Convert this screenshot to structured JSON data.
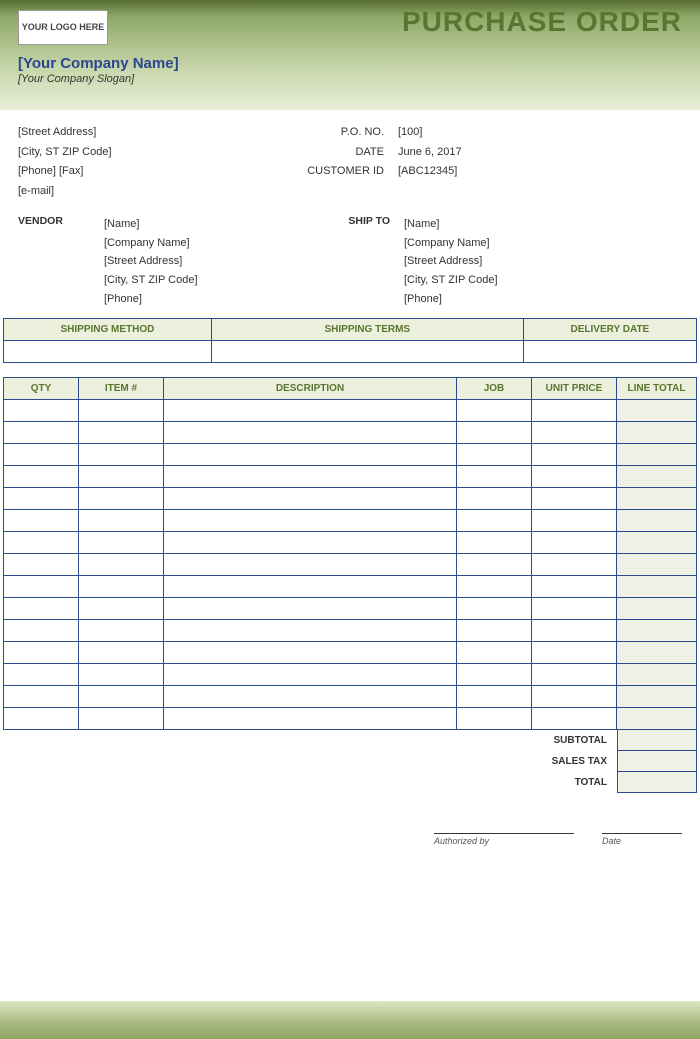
{
  "header": {
    "logo_text": "YOUR LOGO HERE",
    "title": "PURCHASE ORDER",
    "company_name": "[Your Company Name]",
    "company_slogan": "[Your Company Slogan]"
  },
  "sender": {
    "street": "[Street Address]",
    "city": "[City, ST  ZIP Code]",
    "phone_fax": "[Phone] [Fax]",
    "email": "[e-mail]"
  },
  "po_meta": {
    "po_no_label": "P.O. NO.",
    "po_no_value": "[100]",
    "date_label": "DATE",
    "date_value": "June 6, 2017",
    "customer_id_label": "CUSTOMER ID",
    "customer_id_value": "[ABC12345]"
  },
  "vendor": {
    "label": "VENDOR",
    "name": "[Name]",
    "company": "[Company Name]",
    "street": "[Street Address]",
    "city": "[City, ST  ZIP Code]",
    "phone": "[Phone]"
  },
  "shipto": {
    "label": "SHIP TO",
    "name": "[Name]",
    "company": "[Company Name]",
    "street": "[Street Address]",
    "city": "[City, ST  ZIP Code]",
    "phone": "[Phone]"
  },
  "shipping": {
    "headers": {
      "method": "SHIPPING METHOD",
      "terms": "SHIPPING TERMS",
      "delivery": "DELIVERY DATE"
    },
    "values": {
      "method": "",
      "terms": "",
      "delivery": ""
    }
  },
  "items_headers": {
    "qty": "QTY",
    "item": "ITEM #",
    "desc": "DESCRIPTION",
    "job": "JOB",
    "price": "UNIT PRICE",
    "total": "LINE TOTAL"
  },
  "line_items": [
    {
      "qty": "",
      "item": "",
      "desc": "",
      "job": "",
      "price": "",
      "total": ""
    },
    {
      "qty": "",
      "item": "",
      "desc": "",
      "job": "",
      "price": "",
      "total": ""
    },
    {
      "qty": "",
      "item": "",
      "desc": "",
      "job": "",
      "price": "",
      "total": ""
    },
    {
      "qty": "",
      "item": "",
      "desc": "",
      "job": "",
      "price": "",
      "total": ""
    },
    {
      "qty": "",
      "item": "",
      "desc": "",
      "job": "",
      "price": "",
      "total": ""
    },
    {
      "qty": "",
      "item": "",
      "desc": "",
      "job": "",
      "price": "",
      "total": ""
    },
    {
      "qty": "",
      "item": "",
      "desc": "",
      "job": "",
      "price": "",
      "total": ""
    },
    {
      "qty": "",
      "item": "",
      "desc": "",
      "job": "",
      "price": "",
      "total": ""
    },
    {
      "qty": "",
      "item": "",
      "desc": "",
      "job": "",
      "price": "",
      "total": ""
    },
    {
      "qty": "",
      "item": "",
      "desc": "",
      "job": "",
      "price": "",
      "total": ""
    },
    {
      "qty": "",
      "item": "",
      "desc": "",
      "job": "",
      "price": "",
      "total": ""
    },
    {
      "qty": "",
      "item": "",
      "desc": "",
      "job": "",
      "price": "",
      "total": ""
    },
    {
      "qty": "",
      "item": "",
      "desc": "",
      "job": "",
      "price": "",
      "total": ""
    },
    {
      "qty": "",
      "item": "",
      "desc": "",
      "job": "",
      "price": "",
      "total": ""
    },
    {
      "qty": "",
      "item": "",
      "desc": "",
      "job": "",
      "price": "",
      "total": ""
    }
  ],
  "totals": {
    "subtotal_label": "SUBTOTAL",
    "subtotal_value": "",
    "tax_label": "SALES TAX",
    "tax_value": "",
    "total_label": "TOTAL",
    "total_value": ""
  },
  "signature": {
    "auth_label": "Authorized by",
    "date_label": "Date"
  }
}
